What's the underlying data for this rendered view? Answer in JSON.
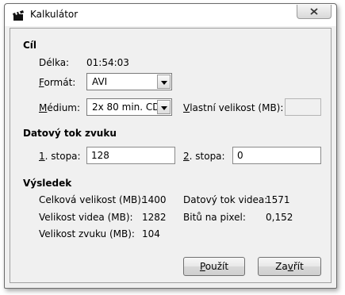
{
  "window": {
    "title": "Kalkulátor",
    "close_icon": "close-x"
  },
  "target": {
    "heading": "Cíl",
    "length_label": "Délka:",
    "length_value": "01:54:03",
    "format_label_u": "F",
    "format_label_rest": "ormát:",
    "format_value": "AVI",
    "medium_label_u": "M",
    "medium_label_rest": "édium:",
    "medium_value": "2x 80 min. CD",
    "custom_size_label_u": "V",
    "custom_size_label_rest": "lastní velikost (MB):",
    "custom_size_value": ""
  },
  "audio": {
    "heading": "Datový tok zvuku",
    "track1_label_u": "1",
    "track1_label_rest": ". stopa:",
    "track1_value": "128",
    "track2_label_u": "2",
    "track2_label_rest": ". stopa:",
    "track2_value": "0"
  },
  "result": {
    "heading": "Výsledek",
    "total_size_label": "Celková velikost (MB):",
    "total_size_value": "1400",
    "video_bitrate_label": "Datový tok videa:",
    "video_bitrate_value": "1571",
    "video_size_label": "Velikost videa (MB):",
    "video_size_value": "1282",
    "bits_per_pixel_label": "Bitů na pixel:",
    "bits_per_pixel_value": "0,152",
    "audio_size_label": "Velikost zvuku (MB):",
    "audio_size_value": "104"
  },
  "buttons": {
    "apply_u": "P",
    "apply_rest": "oužít",
    "close_pre": "Za",
    "close_u": "v",
    "close_rest": "řít"
  }
}
